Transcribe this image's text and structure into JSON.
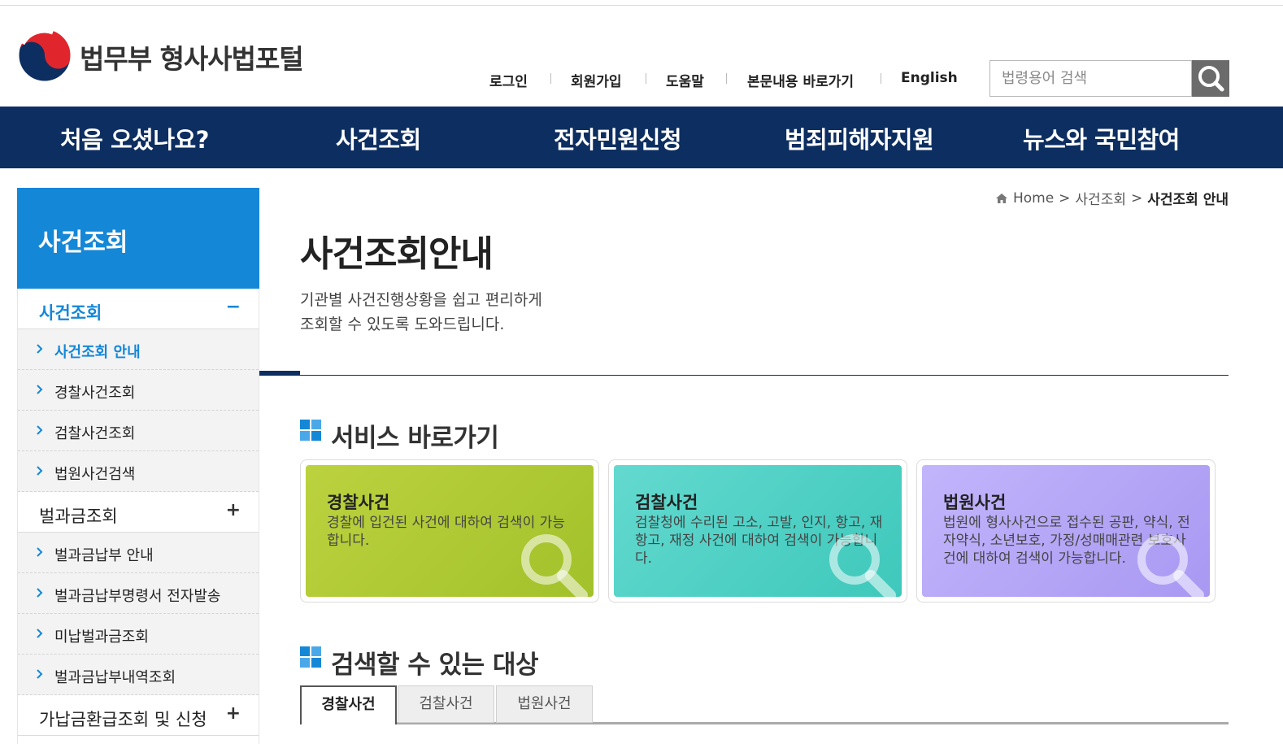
{
  "header": {
    "site_title": "법무부 형사사법포털",
    "util_links": [
      "로그인",
      "회원가입",
      "도움말",
      "본문내용 바로가기",
      "English"
    ],
    "search_placeholder": "법령용어 검색"
  },
  "gnb": [
    "처음 오셨나요?",
    "사건조회",
    "전자민원신청",
    "범죄피해자지원",
    "뉴스와 국민참여"
  ],
  "sidebar": {
    "title": "사건조회",
    "groups": [
      {
        "label": "사건조회",
        "toggle": "−",
        "items": [
          "사건조회 안내",
          "경찰사건조회",
          "검찰사건조회",
          "법원사건검색"
        ]
      },
      {
        "label": "벌과금조회",
        "toggle": "+",
        "items": [
          "벌과금납부 안내",
          "벌과금납부명령서 전자발송",
          "미납벌과금조회",
          "벌과금납부내역조회"
        ]
      },
      {
        "label": "가납금환급조회 및 신청",
        "toggle": "+"
      }
    ]
  },
  "breadcrumb": {
    "home": "Home",
    "sep": ">",
    "section": "사건조회",
    "current": "사건조회 안내"
  },
  "main": {
    "title": "사건조회안내",
    "description": "기관별 사건진행상황을 쉽고 편리하게\n조회할 수 있도록 도와드립니다.",
    "service_heading": "서비스 바로가기",
    "cards": [
      {
        "title": "경찰사건",
        "text": "경찰에 입건된 사건에 대하여 검색이 가능합니다.",
        "color": "#b2cb33"
      },
      {
        "title": "검찰사건",
        "text": "검찰청에 수리된 고소, 고발, 인지, 항고, 재항고, 재정 사건에 대하여 검색이 가능합니다.",
        "color": "#4fd3c6"
      },
      {
        "title": "법원사건",
        "text": "법원에 형사사건으로 접수된 공판, 약식, 전자약식, 소년보호, 가정/성매매관련 보호사건에 대하여 검색이 가능합니다.",
        "color": "#b9a9f8"
      }
    ],
    "target_heading": "검색할 수 있는 대상",
    "tabs": [
      "경찰사건",
      "검찰사건",
      "법원사건"
    ]
  },
  "colors": {
    "navy": "#0d2e60",
    "blue": "#1487d7"
  }
}
